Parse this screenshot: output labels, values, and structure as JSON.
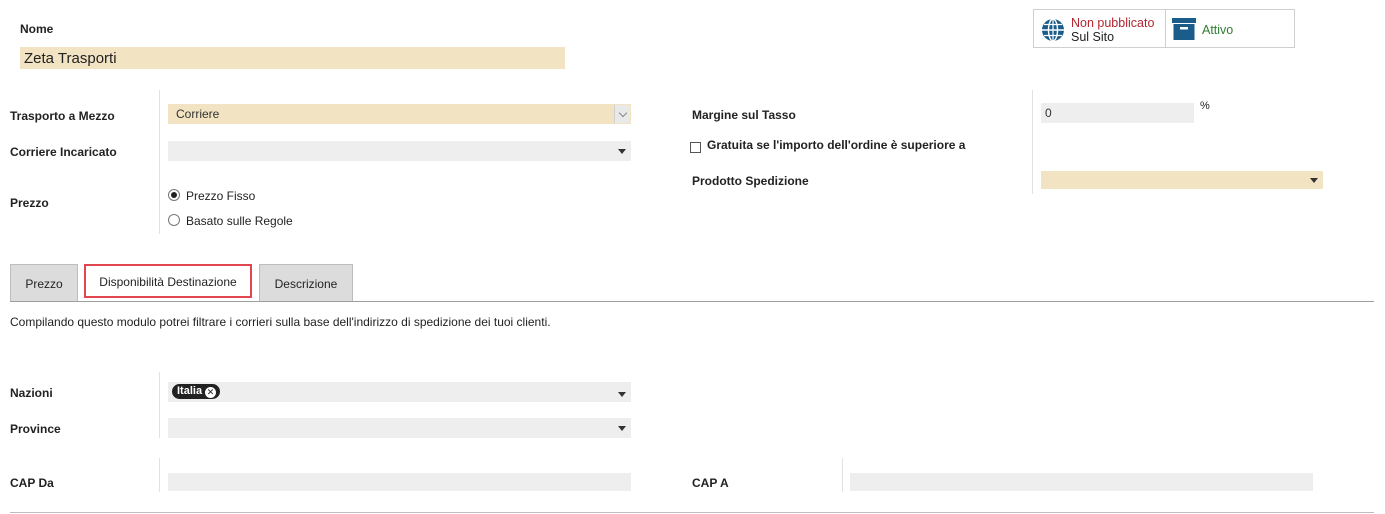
{
  "header": {
    "name_label": "Nome",
    "name_value": "Zeta Trasporti"
  },
  "status": {
    "publish_line1": "Non pubblicato",
    "publish_line2": "Sul Sito",
    "active_label": "Attivo",
    "colors": {
      "unpublished": "#b0282f",
      "active": "#2e7d32",
      "icon": "#1a5c8a"
    }
  },
  "form": {
    "transport_label": "Trasporto a Mezzo",
    "transport_value": "Corriere",
    "carrier_label": "Corriere Incaricato",
    "carrier_value": "",
    "price_label": "Prezzo",
    "price_options": [
      "Prezzo Fisso",
      "Basato sulle Regole"
    ],
    "price_selected": "Prezzo Fisso",
    "margin_label": "Margine sul Tasso",
    "margin_value": "0",
    "margin_unit": "%",
    "free_label": "Gratuita se l'importo dell'ordine è superiore a",
    "product_label": "Prodotto Spedizione",
    "product_value": ""
  },
  "tabs": [
    {
      "label": "Prezzo",
      "active": false
    },
    {
      "label": "Disponibilità Destinazione",
      "active": true
    },
    {
      "label": "Descrizione",
      "active": false
    }
  ],
  "destination": {
    "description": "Compilando questo modulo potrei filtrare i corrieri sulla base dell'indirizzo di spedizione dei tuoi clienti.",
    "countries_label": "Nazioni",
    "countries_tags": [
      "Italia"
    ],
    "provinces_label": "Province",
    "provinces_value": "",
    "zip_from_label": "CAP Da",
    "zip_from_value": "",
    "zip_to_label": "CAP A",
    "zip_to_value": ""
  }
}
